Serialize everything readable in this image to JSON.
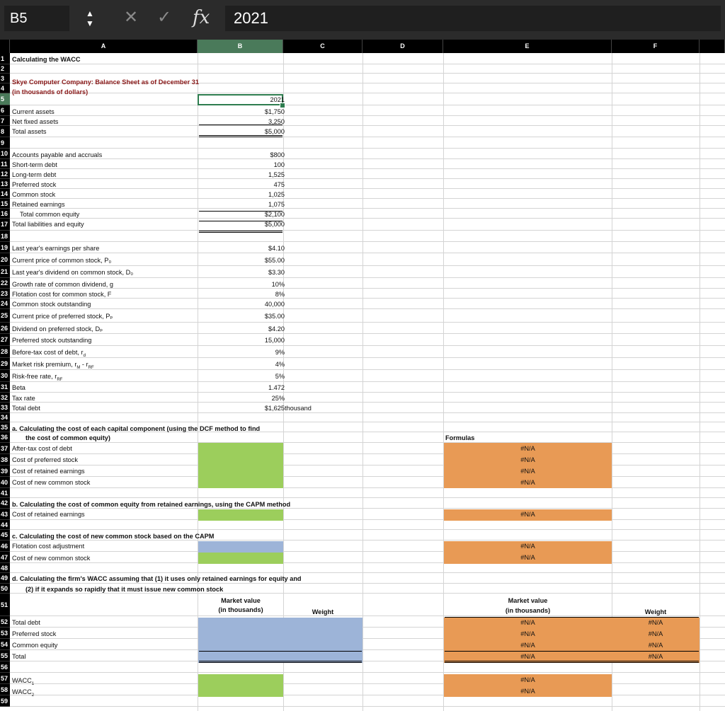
{
  "formula_bar": {
    "cell_ref": "B5",
    "cancel_glyph": "✕",
    "confirm_glyph": "✓",
    "fx_label": "fx",
    "content": "2021"
  },
  "columns": [
    "A",
    "B",
    "C",
    "D",
    "E",
    "F"
  ],
  "selected_cell": "B5",
  "cells": {
    "r1": "Calculating the WACC",
    "r3": "Skye Computer Company: Balance Sheet as of December 31",
    "r4": "(in thousands of dollars)",
    "b5": "2021",
    "r6": "Current assets",
    "b6": "$1,750",
    "r7": "Net fixed assets",
    "b7": "3,250",
    "r8": "Total assets",
    "b8": "$5,000",
    "r10": "Accounts payable and accruals",
    "b10": "$800",
    "r11": "Short-term debt",
    "b11": "100",
    "r12": "Long-term debt",
    "b12": "1,525",
    "r13": "Preferred stock",
    "b13": "475",
    "r14": "Common stock",
    "b14": "1,025",
    "r15": "Retained earnings",
    "b15": "1,075",
    "r16": "Total common equity",
    "b16": "$2,100",
    "r17": "Total liabilities and equity",
    "b17": "$5,000",
    "r19": "Last year's earnings per share",
    "b19": "$4.10",
    "r20": "Current price of common stock, P₀",
    "b20": "$55.00",
    "r21": "Last year's dividend on common stock, D₀",
    "b21": "$3.30",
    "r22": "Growth rate of common dividend, g",
    "b22": "10%",
    "r23": "Flotation cost for common stock, F",
    "b23": "8%",
    "r24": "Common stock outstanding",
    "b24": "40,000",
    "r25": "Current price of preferred stock, Pₚ",
    "b25": "$35.00",
    "r26": "Dividend on preferred stock, Dₚ",
    "b26": "$4.20",
    "r27": "Preferred stock outstanding",
    "b27": "15,000",
    "r28": "Before-tax cost of debt, r",
    "r28sub": "d",
    "b28": "9%",
    "r29": "Market risk premium, r",
    "r29sub1": "M",
    "r29mid": " - r",
    "r29sub2": "RF",
    "b29": "4%",
    "r30": "Risk-free rate, r",
    "r30sub": "RF",
    "b30": "5%",
    "r31": "Beta",
    "b31": "1.472",
    "r32": "Tax rate",
    "b32": "25%",
    "r33": "Total debt",
    "b33": "$1,625",
    "c33": "thousand",
    "r35": "a.  Calculating the cost of each capital component (using the DCF method to find",
    "r36": "the cost of common equity)",
    "e36": "Formulas",
    "r37": "After-tax cost of debt",
    "r38": "Cost of preferred stock",
    "r39": "Cost of retained earnings",
    "r40": "Cost of new common stock",
    "r42": "b.  Calculating the cost of common equity from retained earnings, using the CAPM method",
    "r43": "Cost of retained earnings",
    "r45": "c.  Calculating the cost of new common stock based on the CAPM",
    "r46": "Flotation cost adjustment",
    "r47": "Cost of new common stock",
    "r49": "d.  Calculating the firm's WACC assuming that (1) it uses only retained earnings for equity and",
    "r50": "(2) if it expands so rapidly that it must issue new common stock",
    "hdr_mv1": "Market value",
    "hdr_mv2": "(in thousands)",
    "hdr_weight": "Weight",
    "r52": "Total debt",
    "r53": "Preferred stock",
    "r54": "Common equity",
    "r55": "Total",
    "r57": "WACC",
    "r57sub": "1",
    "r58": "WACC",
    "r58sub": "2",
    "na": "#N/A"
  }
}
